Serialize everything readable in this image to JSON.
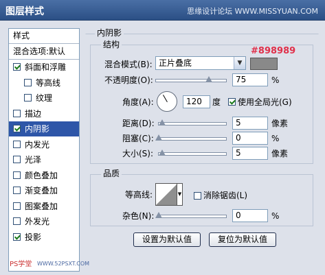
{
  "window": {
    "title": "图层样式",
    "watermark": "思缘设计论坛 WWW.MISSYUAN.COM"
  },
  "sidebar": {
    "header": "样式",
    "blend_options": "混合选项:默认",
    "items": [
      {
        "label": "斜面和浮雕",
        "checked": true
      },
      {
        "label": "等高线",
        "checked": false
      },
      {
        "label": "纹理",
        "checked": false
      },
      {
        "label": "描边",
        "checked": false
      },
      {
        "label": "内阴影",
        "checked": true,
        "selected": true
      },
      {
        "label": "内发光",
        "checked": false
      },
      {
        "label": "光泽",
        "checked": false
      },
      {
        "label": "颜色叠加",
        "checked": false
      },
      {
        "label": "渐变叠加",
        "checked": false
      },
      {
        "label": "图案叠加",
        "checked": false
      },
      {
        "label": "外发光",
        "checked": false
      },
      {
        "label": "投影",
        "checked": true
      }
    ],
    "logo": "PS学堂",
    "logo_url": "WWW.52PSXT.COM"
  },
  "panel": {
    "title": "内阴影",
    "structure": {
      "title": "结构",
      "blend_mode_label": "混合模式(B):",
      "blend_mode_value": "正片叠底",
      "color_hex": "#898989",
      "opacity_label": "不透明度(O):",
      "opacity_value": "75",
      "opacity_fraction": 0.75,
      "opacity_unit": "%",
      "angle_label": "角度(A):",
      "angle_value": "120",
      "angle_unit": "度",
      "global_light_label": "使用全局光(G)",
      "global_light_checked": true,
      "distance_label": "距离(D):",
      "distance_value": "5",
      "distance_unit": "像素",
      "choke_label": "阻塞(C):",
      "choke_value": "0",
      "choke_unit": "%",
      "size_label": "大小(S):",
      "size_value": "5",
      "size_unit": "像素"
    },
    "quality": {
      "title": "品质",
      "contour_label": "等高线:",
      "antialias_label": "消除锯齿(L)",
      "antialias_checked": false,
      "noise_label": "杂色(N):",
      "noise_value": "0",
      "noise_unit": "%"
    },
    "buttons": {
      "set_default": "设置为默认值",
      "reset_default": "复位为默认值"
    }
  }
}
